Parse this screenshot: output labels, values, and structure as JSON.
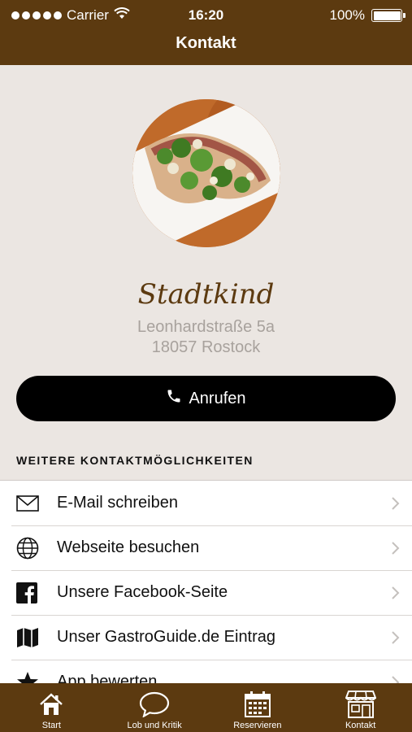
{
  "status_bar": {
    "carrier": "Carrier",
    "time": "16:20",
    "battery": "100%"
  },
  "nav": {
    "title": "Kontakt"
  },
  "venue": {
    "name": "Stadtkind",
    "address_line1": "Leonhardstraße 5a",
    "address_line2": "18057 Rostock"
  },
  "call_button": {
    "label": "Anrufen",
    "icon": "phone-icon"
  },
  "section": {
    "title": "WEITERE KONTAKTMÖGLICHKEITEN"
  },
  "contact_options": [
    {
      "label": "E-Mail schreiben",
      "icon": "envelope-icon"
    },
    {
      "label": "Webseite besuchen",
      "icon": "globe-icon"
    },
    {
      "label": "Unsere Facebook-Seite",
      "icon": "facebook-icon"
    },
    {
      "label": "Unser GastroGuide.de Eintrag",
      "icon": "map-icon"
    },
    {
      "label": "App bewerten",
      "icon": "star-icon"
    }
  ],
  "tabs": [
    {
      "label": "Start",
      "icon": "home-icon"
    },
    {
      "label": "Lob und Kritik",
      "icon": "speech-bubble-icon"
    },
    {
      "label": "Reservieren",
      "icon": "calendar-icon"
    },
    {
      "label": "Kontakt",
      "icon": "storefront-icon"
    }
  ],
  "colors": {
    "brand": "#5c3a10",
    "background": "#ebe6e2",
    "button": "#000000"
  }
}
